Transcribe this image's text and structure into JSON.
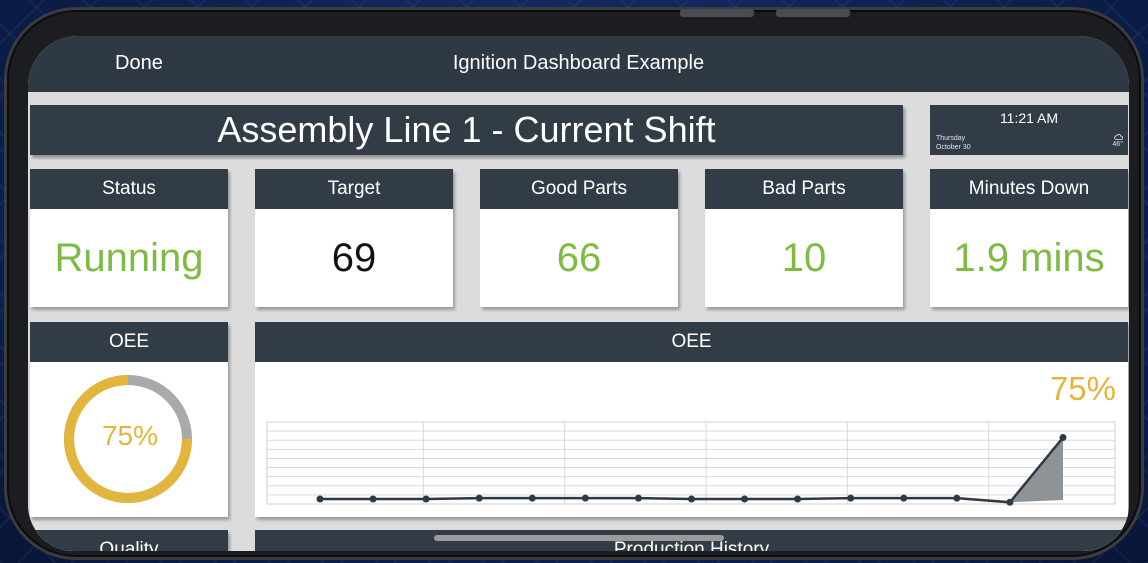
{
  "nav": {
    "done_label": "Done",
    "title": "Ignition Dashboard Example"
  },
  "header": {
    "title": "Assembly Line 1 - Current Shift"
  },
  "clock": {
    "time": "11:21 AM",
    "weekday": "Thursday",
    "date": "October 30",
    "temperature": "46°",
    "weather_icon": "cloud-icon"
  },
  "tiles": [
    {
      "label": "Status",
      "value": "Running",
      "color": "#7dbb42"
    },
    {
      "label": "Target",
      "value": "69",
      "color": "#111111"
    },
    {
      "label": "Good Parts",
      "value": "66",
      "color": "#7dbb42"
    },
    {
      "label": "Bad Parts",
      "value": "10",
      "color": "#7dbb42"
    },
    {
      "label": "Minutes Down",
      "value": "1.9 mins",
      "color": "#7dbb42"
    }
  ],
  "oee_gauge": {
    "label": "OEE",
    "value_text": "75%",
    "fraction": 0.75,
    "fill_color": "#e2b53c",
    "track_color": "#a9a9a9"
  },
  "oee_trend": {
    "label": "OEE",
    "current_text": "75%"
  },
  "chart_data": {
    "type": "line",
    "title": "",
    "xlabel": "",
    "ylabel": "",
    "ylim": [
      0,
      100
    ],
    "grid": true,
    "color": "#2f3943",
    "fill_color": "#8e9398",
    "values": [
      0,
      0,
      0,
      1,
      1,
      1,
      1,
      0,
      0,
      0,
      1,
      1,
      1,
      -4,
      75
    ]
  },
  "bottom_cards": {
    "quality_label": "Quality",
    "history_label": "Production History"
  }
}
